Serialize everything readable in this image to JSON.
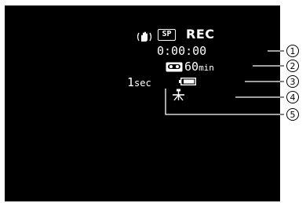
{
  "osd": {
    "stabilizer_icon": "image-stabilizer-icon",
    "mode_badge": "SP",
    "status": "REC",
    "time_code": "0:00:00",
    "tape_icon": "cassette-tape-icon",
    "tape_remaining_value": "60",
    "tape_remaining_unit": "min",
    "battery_icon": "battery-icon",
    "interval_value": "1",
    "interval_unit": "sec",
    "tripod_icon": "tripod-icon"
  },
  "callouts": [
    {
      "label": "①"
    },
    {
      "label": "②"
    },
    {
      "label": "③"
    },
    {
      "label": "④"
    },
    {
      "label": "⑤"
    }
  ],
  "colors": {
    "screen_background": "#000000",
    "osd_text": "#ffffff",
    "page_background": "#ffffff"
  }
}
